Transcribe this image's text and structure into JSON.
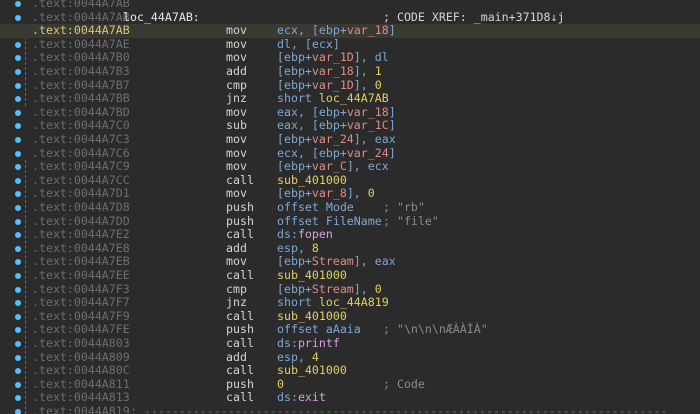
{
  "view": {
    "colors": {
      "background": "#2b2b2b",
      "address": "#6e6e6e",
      "highlight_address": "#d7c97a",
      "operand": "#7fa7d4",
      "symbol": "#e08a8a",
      "function": "#e0d060",
      "breakpoint_dot": "#4fc1ff"
    },
    "lines": [
      {
        "address": ".text:0044A7AB",
        "label": "",
        "mnemonic": "",
        "operands": "",
        "comment": ""
      },
      {
        "address": ".text:0044A7AB",
        "label": "loc_44A7AB:",
        "mnemonic": "",
        "operands": "",
        "comment": "; CODE XREF: _main+371D8↓j"
      },
      {
        "address": ".text:0044A7AB",
        "mnemonic": "mov",
        "operands": "ecx, [ebp+var_18]",
        "active": true
      },
      {
        "address": ".text:0044A7AE",
        "mnemonic": "mov",
        "operands": "dl, [ecx]"
      },
      {
        "address": ".text:0044A7B0",
        "mnemonic": "mov",
        "operands": "[ebp+var_1D], dl"
      },
      {
        "address": ".text:0044A7B3",
        "mnemonic": "add",
        "operands": "[ebp+var_18], 1"
      },
      {
        "address": ".text:0044A7B7",
        "mnemonic": "cmp",
        "operands": "[ebp+var_1D], 0"
      },
      {
        "address": ".text:0044A7BB",
        "mnemonic": "jnz",
        "operands": "short loc_44A7AB"
      },
      {
        "address": ".text:0044A7BD",
        "mnemonic": "mov",
        "operands": "eax, [ebp+var_18]"
      },
      {
        "address": ".text:0044A7C0",
        "mnemonic": "sub",
        "operands": "eax, [ebp+var_1C]"
      },
      {
        "address": ".text:0044A7C3",
        "mnemonic": "mov",
        "operands": "[ebp+var_24], eax"
      },
      {
        "address": ".text:0044A7C6",
        "mnemonic": "mov",
        "operands": "ecx, [ebp+var_24]"
      },
      {
        "address": ".text:0044A7C9",
        "mnemonic": "mov",
        "operands": "[ebp+var_C], ecx"
      },
      {
        "address": ".text:0044A7CC",
        "mnemonic": "call",
        "operands": "sub_401000"
      },
      {
        "address": ".text:0044A7D1",
        "mnemonic": "mov",
        "operands": "[ebp+var_8], 0"
      },
      {
        "address": ".text:0044A7D8",
        "mnemonic": "push",
        "operands": "offset Mode",
        "comment": "; \"rb\""
      },
      {
        "address": ".text:0044A7DD",
        "mnemonic": "push",
        "operands": "offset FileName",
        "comment": "; \"file\""
      },
      {
        "address": ".text:0044A7E2",
        "mnemonic": "call",
        "operands": "ds:fopen"
      },
      {
        "address": ".text:0044A7E8",
        "mnemonic": "add",
        "operands": "esp, 8"
      },
      {
        "address": ".text:0044A7EB",
        "mnemonic": "mov",
        "operands": "[ebp+Stream], eax"
      },
      {
        "address": ".text:0044A7EE",
        "mnemonic": "call",
        "operands": "sub_401000"
      },
      {
        "address": ".text:0044A7F3",
        "mnemonic": "cmp",
        "operands": "[ebp+Stream], 0"
      },
      {
        "address": ".text:0044A7F7",
        "mnemonic": "jnz",
        "operands": "short loc_44A819"
      },
      {
        "address": ".text:0044A7F9",
        "mnemonic": "call",
        "operands": "sub_401000"
      },
      {
        "address": ".text:0044A7FE",
        "mnemonic": "push",
        "operands": "offset aAaia",
        "comment": "; \"\\n\\n\\nÆÀÀÌÀ\""
      },
      {
        "address": ".text:0044A803",
        "mnemonic": "call",
        "operands": "ds:printf"
      },
      {
        "address": ".text:0044A809",
        "mnemonic": "add",
        "operands": "esp, 4"
      },
      {
        "address": ".text:0044A80C",
        "mnemonic": "call",
        "operands": "sub_401000"
      },
      {
        "address": ".text:0044A811",
        "mnemonic": "push",
        "operands": "0",
        "comment": "; Code"
      },
      {
        "address": ".text:0044A813",
        "mnemonic": "call",
        "operands": "ds:exit"
      },
      {
        "address": ".text:0044A819",
        "separator": "; ---------------------------------------------------------------------------"
      }
    ]
  }
}
